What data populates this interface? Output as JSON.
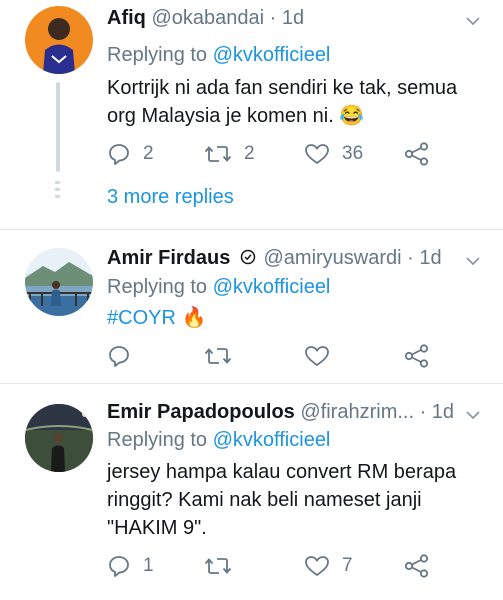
{
  "tweets": [
    {
      "name": "Afiq",
      "handle": "@okabandai",
      "time": "· 1d",
      "reply_prefix": "Replying to ",
      "reply_mention": "@kvkofficieel",
      "text_line1": "Kortrijk ni ada fan sendiri ke tak, semua",
      "text_line2": "org Malaysia je komen ni. 😂",
      "reply_count": "2",
      "retweet_count": "2",
      "like_count": "36",
      "more_replies": "3 more replies"
    },
    {
      "name": "Amir Firdaus",
      "handle": "@amiryuswardi",
      "time": "· 1d",
      "reply_prefix": "Replying to ",
      "reply_mention": "@kvkofficieel",
      "text": "#COYR 🔥",
      "reply_count": "",
      "retweet_count": "",
      "like_count": ""
    },
    {
      "name": "Emir Papadopoulos",
      "handle": "@firahzrim...",
      "time": "· 1d",
      "reply_prefix": "Replying to ",
      "reply_mention": "@kvkofficieel",
      "text_line1": "jersey hampa kalau convert RM berapa",
      "text_line2": "ringgit? Kami nak beli nameset janji",
      "text_line3": "\"HAKIM 9\".",
      "reply_count": "1",
      "retweet_count": "",
      "like_count": "7"
    }
  ],
  "icons": {
    "reply": "reply-icon",
    "retweet": "retweet-icon",
    "like": "heart-icon",
    "share": "share-icon",
    "menu": "chevron-down-icon",
    "verified": "verified-badge-icon"
  },
  "colors": {
    "link": "#1b95e0",
    "muted": "#657786",
    "divider": "#e1e8ed"
  }
}
